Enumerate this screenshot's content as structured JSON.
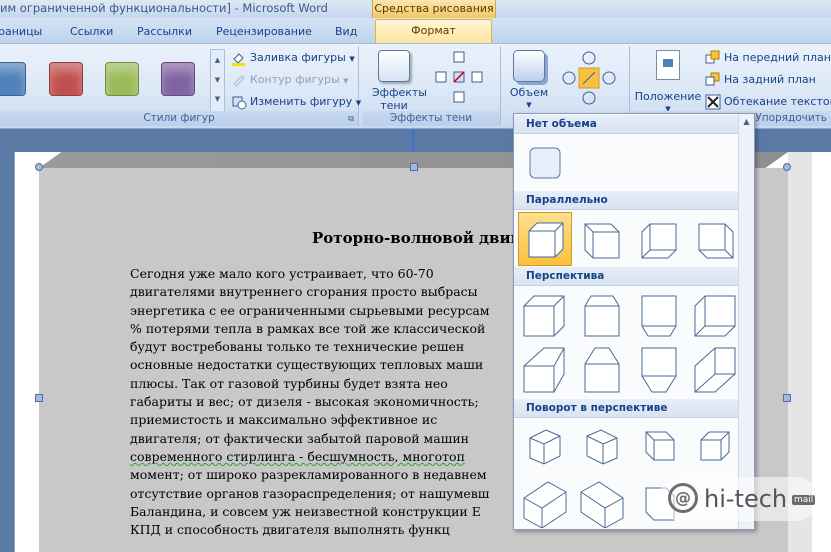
{
  "window": {
    "title": "им ограниченной функциональности] - Microsoft Word",
    "context_tab_group": "Средства рисования"
  },
  "tabs": [
    {
      "label": "раницы"
    },
    {
      "label": "Ссылки"
    },
    {
      "label": "Рассылки"
    },
    {
      "label": "Рецензирование"
    },
    {
      "label": "Вид"
    },
    {
      "label": "Формат"
    }
  ],
  "ribbon": {
    "shape_styles": {
      "label": "Стили фигур",
      "swatches": [
        "#4f81bd",
        "#c0504d",
        "#9bbb59",
        "#8064a2"
      ],
      "fill": "Заливка фигуры",
      "outline": "Контур фигуры",
      "change": "Изменить фигуру"
    },
    "shadow_effects": {
      "label": "Эффекты тени",
      "button": "Эффекты тени"
    },
    "volume": {
      "button": "Объем"
    },
    "arrange": {
      "label": "Упорядочить",
      "position": "Положение",
      "front": "На передний план",
      "back": "На задний план",
      "wrap": "Обтекание текстом"
    }
  },
  "document": {
    "title": "Роторно-волновой двиг",
    "lines": [
      "Сегодня уже мало кого устраивает, что 60-70",
      "двигателями внутреннего сгорания просто выбрасы",
      "энергетика с ее ограниченными сырьевыми ресурсам",
      "% потерями тепла в рамках все той же классической",
      "будут востребованы только те технические решен",
      "основные недостатки существующих тепловых маши",
      "плюсы. Так от газовой турбины будет взята нео",
      "габариты и вес; от дизеля - высокая экономичность;",
      "приемистость и максимально эффективное ис",
      "двигателя; от фактически забытой паровой машин",
      "современного стирлинга - бесшумность, многотоп",
      "момент; от широко разрекламированного в недавнем",
      "отсутствие органов газораспределения; от нашумевш",
      "Баландина, и совсем уж неизвестной конструкции Е",
      "КПД и способность двигателя выполнять функц"
    ]
  },
  "dropdown": {
    "sections": [
      {
        "title": "Нет объема"
      },
      {
        "title": "Параллельно"
      },
      {
        "title": "Перспектива"
      },
      {
        "title": "Поворот в перспективе"
      }
    ]
  },
  "watermark": {
    "icon_letter": "@",
    "text": "hi-tech",
    "tld": "mail"
  }
}
